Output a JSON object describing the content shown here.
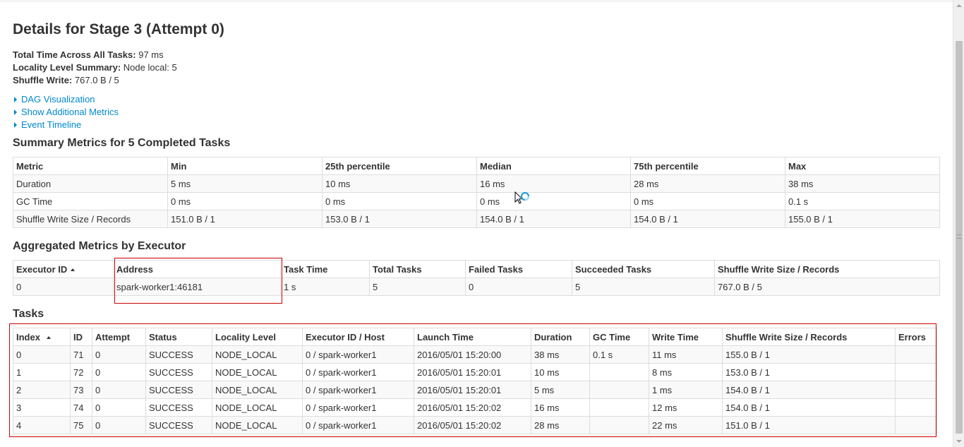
{
  "page": {
    "title": "Details for Stage 3 (Attempt 0)",
    "summary": [
      {
        "label": "Total Time Across All Tasks:",
        "value": "97 ms"
      },
      {
        "label": "Locality Level Summary:",
        "value": "Node local: 5"
      },
      {
        "label": "Shuffle Write:",
        "value": "767.0 B / 5"
      }
    ],
    "toggles": [
      "DAG Visualization",
      "Show Additional Metrics",
      "Event Timeline"
    ]
  },
  "summary_metrics": {
    "heading": "Summary Metrics for 5 Completed Tasks",
    "columns": [
      "Metric",
      "Min",
      "25th percentile",
      "Median",
      "75th percentile",
      "Max"
    ],
    "rows": [
      [
        "Duration",
        "5 ms",
        "10 ms",
        "16 ms",
        "28 ms",
        "38 ms"
      ],
      [
        "GC Time",
        "0 ms",
        "0 ms",
        "0 ms",
        "0 ms",
        "0.1 s"
      ],
      [
        "Shuffle Write Size / Records",
        "151.0 B / 1",
        "153.0 B / 1",
        "154.0 B / 1",
        "154.0 B / 1",
        "155.0 B / 1"
      ]
    ]
  },
  "executor_metrics": {
    "heading": "Aggregated Metrics by Executor",
    "columns": [
      "Executor ID",
      "Address",
      "Task Time",
      "Total Tasks",
      "Failed Tasks",
      "Succeeded Tasks",
      "Shuffle Write Size / Records"
    ],
    "rows": [
      [
        "0",
        "spark-worker1:46181",
        "1 s",
        "5",
        "0",
        "5",
        "767.0 B / 5"
      ]
    ]
  },
  "tasks": {
    "heading": "Tasks",
    "columns": [
      "Index",
      "ID",
      "Attempt",
      "Status",
      "Locality Level",
      "Executor ID / Host",
      "Launch Time",
      "Duration",
      "GC Time",
      "Write Time",
      "Shuffle Write Size / Records",
      "Errors"
    ],
    "rows": [
      [
        "0",
        "71",
        "0",
        "SUCCESS",
        "NODE_LOCAL",
        "0 / spark-worker1",
        "2016/05/01 15:20:00",
        "38 ms",
        "0.1 s",
        "11 ms",
        "155.0 B / 1",
        ""
      ],
      [
        "1",
        "72",
        "0",
        "SUCCESS",
        "NODE_LOCAL",
        "0 / spark-worker1",
        "2016/05/01 15:20:01",
        "10 ms",
        "",
        "8 ms",
        "153.0 B / 1",
        ""
      ],
      [
        "2",
        "73",
        "0",
        "SUCCESS",
        "NODE_LOCAL",
        "0 / spark-worker1",
        "2016/05/01 15:20:01",
        "5 ms",
        "",
        "1 ms",
        "154.0 B / 1",
        ""
      ],
      [
        "3",
        "74",
        "0",
        "SUCCESS",
        "NODE_LOCAL",
        "0 / spark-worker1",
        "2016/05/01 15:20:02",
        "16 ms",
        "",
        "12 ms",
        "154.0 B / 1",
        ""
      ],
      [
        "4",
        "75",
        "0",
        "SUCCESS",
        "NODE_LOCAL",
        "0 / spark-worker1",
        "2016/05/01 15:20:02",
        "28 ms",
        "",
        "22 ms",
        "151.0 B / 1",
        ""
      ]
    ]
  },
  "icons": {
    "toggle_arrow": "triangle-right-icon",
    "sort_arrow": "sort-ascending-icon",
    "busy_cursor": "busy-cursor-icon"
  },
  "colors": {
    "link": "#0088cc",
    "highlight_box": "#cc0000",
    "row_stripe": "#f9f9f9",
    "border": "#dddddd"
  }
}
